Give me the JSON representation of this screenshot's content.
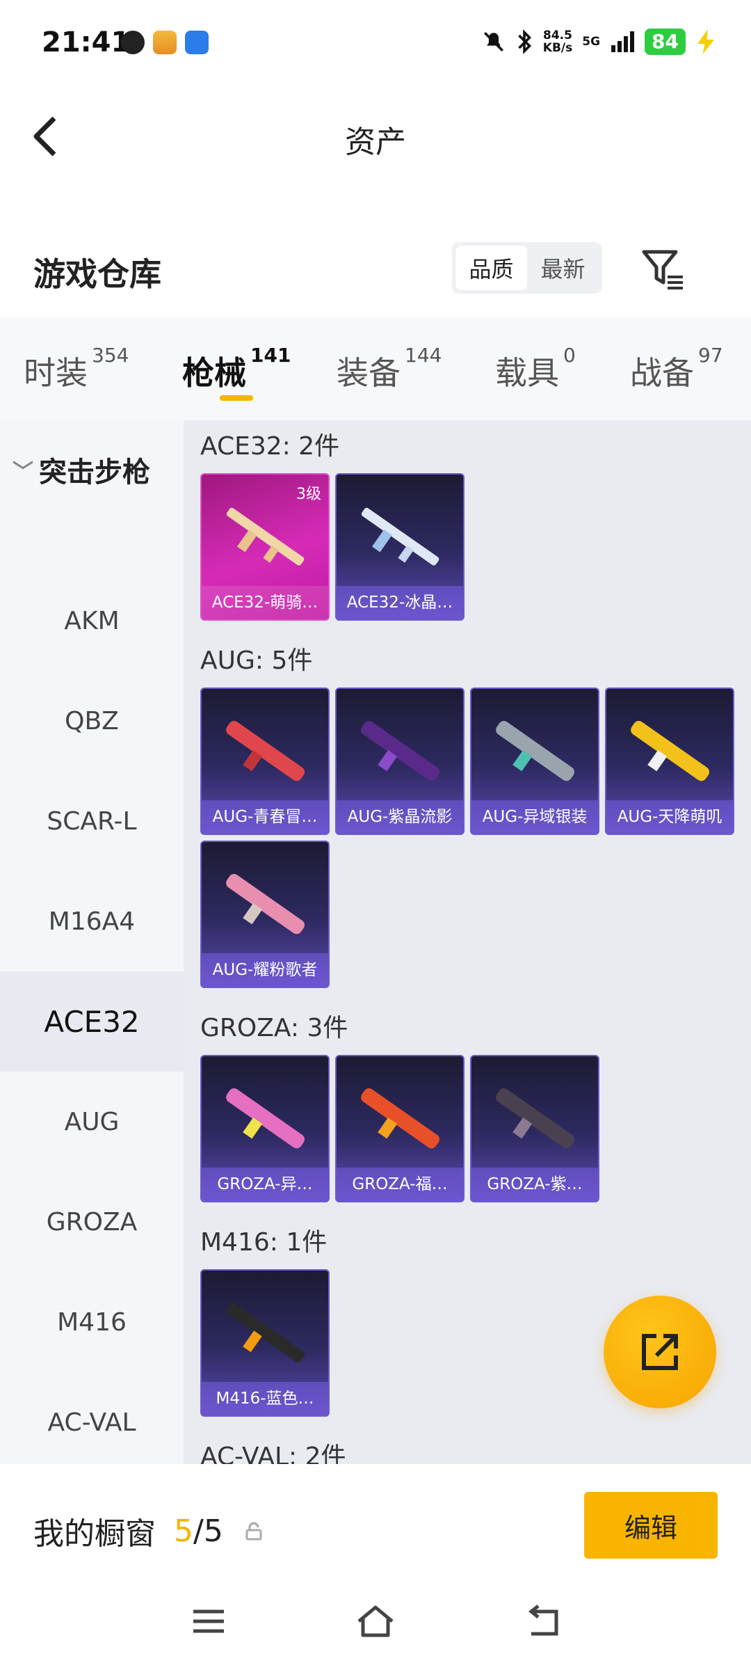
{
  "status_bar": {
    "time": "21:41",
    "speed_value": "84.5",
    "speed_unit": "KB/s",
    "network": "5G",
    "battery": "84",
    "battery_color": "#2ecc40"
  },
  "header": {
    "title": "资产",
    "back_icon": "chevron-left-icon"
  },
  "warehouse": {
    "title": "游戏仓库",
    "sort_options": [
      "品质",
      "最新"
    ],
    "sort_selected": "品质",
    "filter_icon": "filter-icon"
  },
  "tabs": [
    {
      "label": "时装",
      "count": "354"
    },
    {
      "label": "枪械",
      "count": "141",
      "active": true
    },
    {
      "label": "装备",
      "count": "144"
    },
    {
      "label": "载具",
      "count": "0"
    },
    {
      "label": "战备",
      "count": "97"
    }
  ],
  "sidebar": {
    "category": "突击步枪",
    "items": [
      "AKM",
      "QBZ",
      "SCAR-L",
      "M16A4",
      "ACE32",
      "AUG",
      "GROZA",
      "M416",
      "AC-VAL"
    ],
    "active": "ACE32"
  },
  "groups": [
    {
      "label": "ACE32: 2件",
      "items": [
        {
          "name": "ACE32-萌骑…",
          "level": "3级",
          "style": "pink"
        },
        {
          "name": "ACE32-冰晶…"
        }
      ]
    },
    {
      "label": "AUG: 5件",
      "items": [
        {
          "name": "AUG-青春冒…"
        },
        {
          "name": "AUG-紫晶流影"
        },
        {
          "name": "AUG-异域银装"
        },
        {
          "name": "AUG-天降萌叽"
        },
        {
          "name": "AUG-耀粉歌者"
        }
      ]
    },
    {
      "label": "GROZA: 3件",
      "items": [
        {
          "name": "GROZA-异…"
        },
        {
          "name": "GROZA-福…"
        },
        {
          "name": "GROZA-紫…"
        }
      ]
    },
    {
      "label": "M416: 1件",
      "items": [
        {
          "name": "M416-蓝色…"
        }
      ]
    },
    {
      "label": "AC-VAL: 2件",
      "items": []
    }
  ],
  "showcase": {
    "label": "我的橱窗",
    "current": "5",
    "total": "/5",
    "edit_label": "编辑",
    "accent": "#f9b400"
  },
  "nav": {
    "menu_icon": "menu-icon",
    "home_icon": "home-icon",
    "back_icon": "back-icon"
  }
}
